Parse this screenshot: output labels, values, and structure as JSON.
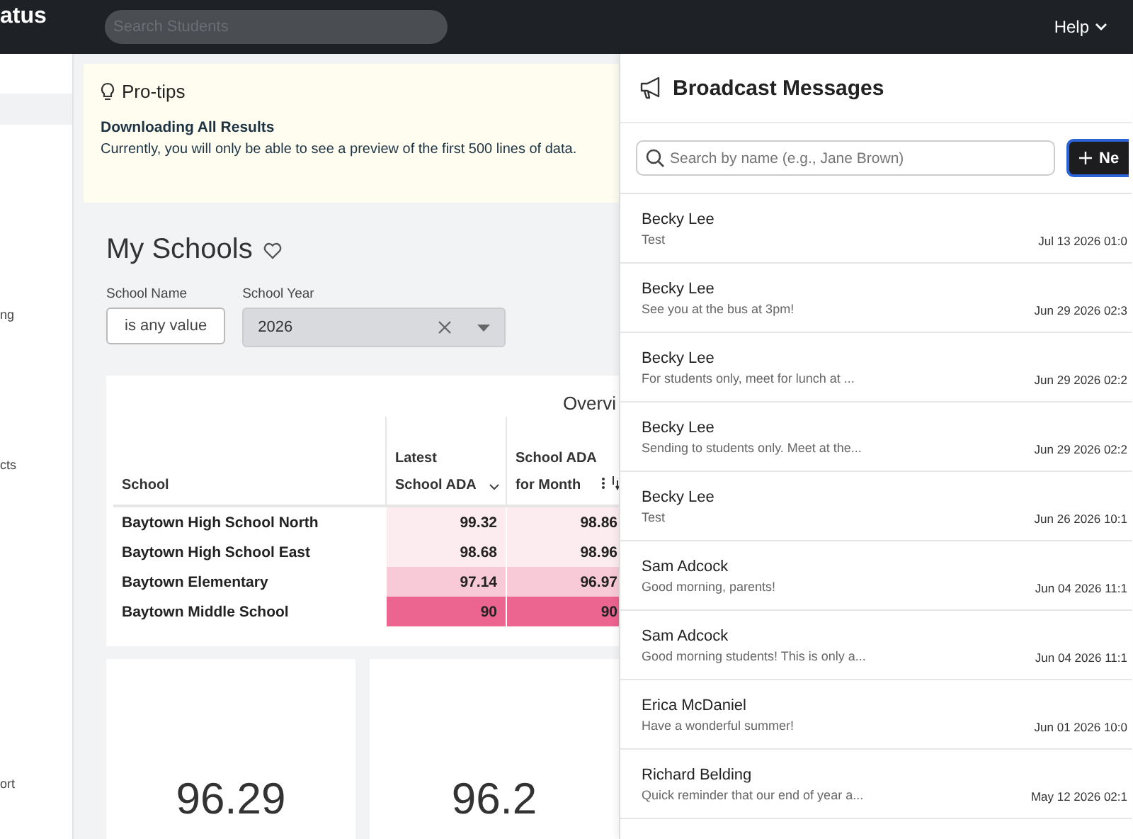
{
  "header": {
    "logo": "atus",
    "search": {
      "placeholder": "Search Students"
    },
    "help": "Help"
  },
  "sidebar": {
    "items": [
      {
        "selected": true
      },
      {
        "label": "ng",
        "selected": false
      },
      {
        "label": "cts",
        "selected": false
      },
      {
        "label": "ort",
        "selected": false
      }
    ]
  },
  "protips": {
    "title": "Pro-tips",
    "heading": "Downloading All Results",
    "text": "Currently, you will only be able to see a preview of the first 500 lines of data."
  },
  "page": {
    "title": "My Schools"
  },
  "filters": [
    {
      "label": "School Name",
      "kind": "text",
      "value": "is any value"
    },
    {
      "label": "School Year",
      "kind": "select",
      "value": "2026"
    }
  ],
  "table": {
    "title": "Overvi",
    "columns": [
      "School",
      "Latest School ADA",
      "School ADA for Month"
    ],
    "rows": [
      {
        "school": "Baytown High School North",
        "values": [
          {
            "text": "99.32",
            "color": "#fcecef"
          },
          {
            "text": "98.86",
            "color": "#fcecef"
          }
        ]
      },
      {
        "school": "Baytown High School East",
        "values": [
          {
            "text": "98.68",
            "color": "#fcecef"
          },
          {
            "text": "98.96",
            "color": "#fcecef"
          }
        ]
      },
      {
        "school": "Baytown Elementary",
        "values": [
          {
            "text": "97.14",
            "color": "#f8cad7"
          },
          {
            "text": "96.97",
            "color": "#f8cad7"
          }
        ]
      },
      {
        "school": "Baytown Middle School",
        "values": [
          {
            "text": "90",
            "color": "#ec6490"
          },
          {
            "text": "90",
            "color": "#ec6490"
          }
        ]
      }
    ]
  },
  "kpis": [
    "96.29",
    "96.2"
  ],
  "broadcast": {
    "title": "Broadcast Messages",
    "search": {
      "placeholder": "Search by name (e.g., Jane Brown)"
    },
    "new_button": "Ne",
    "messages": [
      {
        "name": "Becky Lee",
        "text": "Test",
        "time": "Jul 13 2026 01:0"
      },
      {
        "name": "Becky Lee",
        "text": "See you at the bus at 3pm!",
        "time": "Jun 29 2026 02:3"
      },
      {
        "name": "Becky Lee",
        "text": "For students only, meet for lunch at ...",
        "time": "Jun 29 2026 02:2"
      },
      {
        "name": "Becky Lee",
        "text": "Sending to students only. Meet at the...",
        "time": "Jun 29 2026 02:2"
      },
      {
        "name": "Becky Lee",
        "text": "Test",
        "time": "Jun 26 2026 10:1"
      },
      {
        "name": "Sam Adcock",
        "text": "Good morning, parents!",
        "time": "Jun 04 2026 11:1"
      },
      {
        "name": "Sam Adcock",
        "text": "Good morning students! This is only a...",
        "time": "Jun 04 2026 11:1"
      },
      {
        "name": "Erica McDaniel",
        "text": "Have a wonderful summer!",
        "time": "Jun 01 2026 10:0"
      },
      {
        "name": "Richard Belding",
        "text": "Quick reminder that our end of year a...",
        "time": "May 12 2026 02:1"
      }
    ]
  }
}
